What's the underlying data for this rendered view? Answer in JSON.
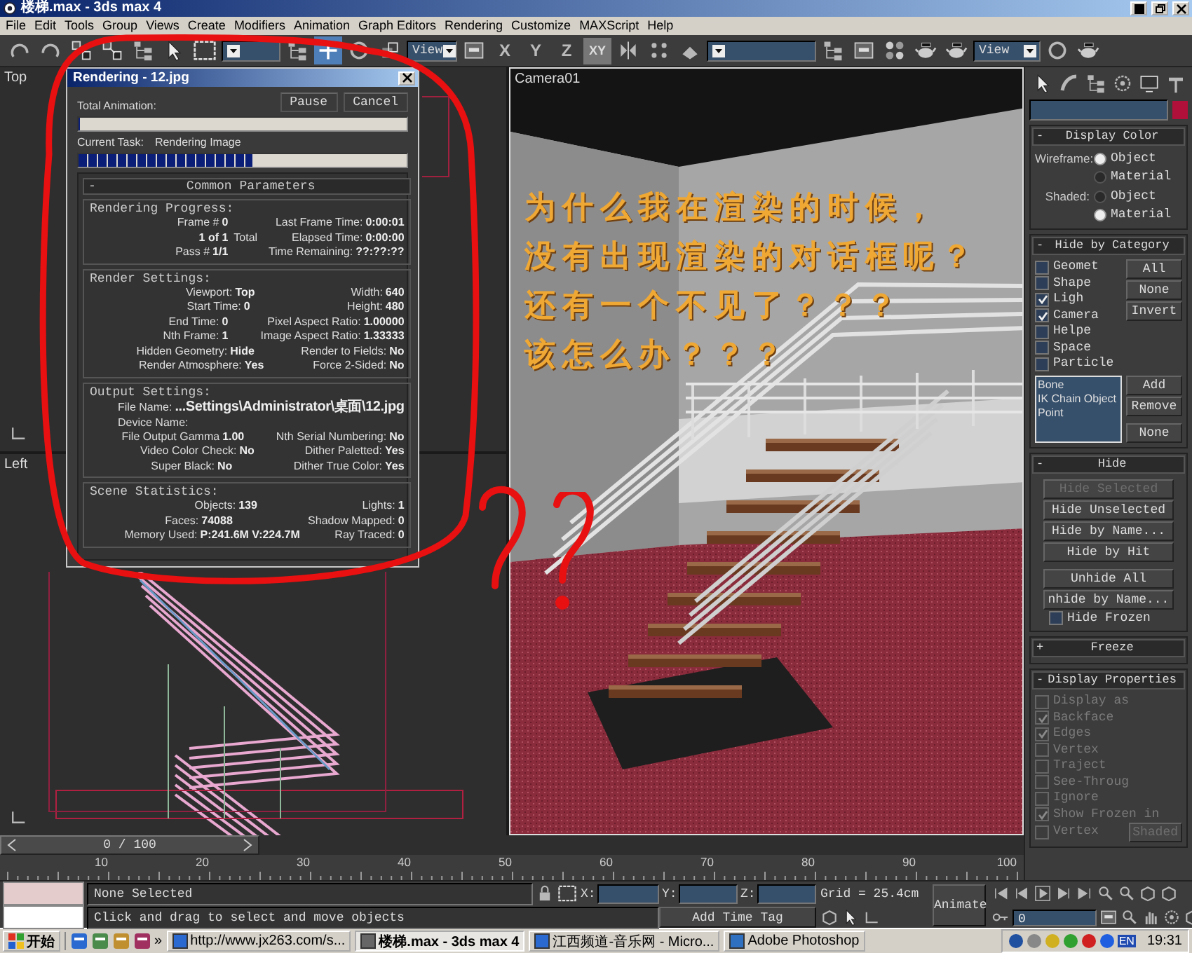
{
  "window": {
    "title": "楼梯.max - 3ds max 4"
  },
  "menu": [
    "File",
    "Edit",
    "Tools",
    "Group",
    "Views",
    "Create",
    "Modifiers",
    "Animation",
    "Graph Editors",
    "Rendering",
    "Customize",
    "MAXScript",
    "Help"
  ],
  "toolbar": {
    "view_dropdowns": [
      "View",
      "View"
    ],
    "axes": [
      {
        "label": "X",
        "selected": false
      },
      {
        "label": "Y",
        "selected": false
      },
      {
        "label": "Z",
        "selected": false
      },
      {
        "label": "XY",
        "selected": true
      }
    ]
  },
  "viewports": [
    {
      "label": "Top",
      "kind": "top"
    },
    {
      "label": "Left",
      "kind": "wireframe"
    },
    {
      "label": "Camera01",
      "kind": "render"
    }
  ],
  "annotation": [
    "为什么我在渲染的时候，",
    "没有出现渲染的对话框呢？",
    "还有一个不见了？？？",
    "该怎么办？？？"
  ],
  "render_dialog": {
    "title": "Rendering - 12.jpg",
    "buttons": [
      "Pause",
      "Cancel"
    ],
    "total": {
      "label": "Total Animation:",
      "level": 0
    },
    "task": {
      "label": "Current Task:",
      "value": "Rendering Image",
      "level": 0.53
    },
    "rollout": {
      "toggle": "-",
      "title": "Common Parameters"
    },
    "groups": [
      {
        "title": "Rendering Progress:",
        "rows": [
          {
            "left": {
              "label": "Frame #",
              "value": "0"
            },
            "right": {
              "label": "Last Frame Time:",
              "value": "0:00:01"
            }
          },
          {
            "left": {
              "value": "1 of 1"
            },
            "middle": "Total",
            "right": {
              "label": "Elapsed Time:",
              "value": "0:00:00"
            }
          },
          {
            "left": {
              "label": "Pass #",
              "value": "1/1"
            },
            "right": {
              "label": "Time Remaining:",
              "value": "??:??:??"
            }
          }
        ]
      },
      {
        "title": "Render Settings:",
        "rows": [
          {
            "left": {
              "label": "Viewport:",
              "value": "Top"
            },
            "right": {
              "label": "Width:",
              "value": "640"
            }
          },
          {
            "left": {
              "label": "Start Time:",
              "value": "0"
            },
            "right": {
              "label": "Height:",
              "value": "480"
            }
          },
          {
            "left": {
              "label": "End Time:",
              "value": "0"
            },
            "right": {
              "label": "Pixel Aspect Ratio:",
              "value": "1.00000"
            }
          },
          {
            "left": {
              "label": "Nth Frame:",
              "value": "1"
            },
            "right": {
              "label": "Image Aspect Ratio:",
              "value": "1.33333"
            }
          },
          {
            "left": {
              "label": "Hidden Geometry:",
              "value": "Hide"
            },
            "right": {
              "label": "Render to Fields:",
              "value": "No"
            }
          },
          {
            "left": {
              "label": "Render Atmosphere:",
              "value": "Yes"
            },
            "right": {
              "label": "Force 2-Sided:",
              "value": "No"
            }
          }
        ]
      },
      {
        "title": "Output Settings:",
        "rows": [
          {
            "full": {
              "label": "File Name:",
              "value": "...Settings\\Administrator\\桌面\\12.jpg"
            }
          },
          {
            "full": {
              "label": "Device Name:"
            }
          },
          {
            "left": {
              "label": "File Output Gamma",
              "value": "1.00"
            },
            "right": {
              "label": "Nth Serial Numbering:",
              "value": "No"
            }
          },
          {
            "left": {
              "label": "Video Color Check:",
              "value": "No"
            },
            "right": {
              "label": "Dither Paletted:",
              "value": "Yes"
            }
          },
          {
            "left": {
              "label": "Super Black:",
              "value": "No"
            },
            "right": {
              "label": "Dither True Color:",
              "value": "Yes"
            }
          }
        ]
      },
      {
        "title": "Scene Statistics:",
        "rows": [
          {
            "left": {
              "label": "Objects:",
              "value": "139"
            },
            "right": {
              "label": "Lights:",
              "value": "1"
            }
          },
          {
            "left": {
              "label": "Faces:",
              "value": "74088"
            },
            "right": {
              "label": "Shadow Mapped:",
              "value": "0"
            }
          },
          {
            "left": {
              "label": "Memory Used:",
              "value": "P:241.6M V:224.7M"
            },
            "right": {
              "label": "Ray Traced:",
              "value": "0"
            }
          }
        ]
      }
    ]
  },
  "command_panel": {
    "rollouts": [
      {
        "kind": "display_color",
        "toggle": "-",
        "title": "Display Color",
        "groups": [
          {
            "label": "Wireframe:",
            "options": [
              {
                "label": "Object",
                "selected": true
              },
              {
                "label": "Material",
                "selected": false
              }
            ]
          },
          {
            "label": "Shaded:",
            "options": [
              {
                "label": "Object",
                "selected": false
              },
              {
                "label": "Material",
                "selected": true
              }
            ]
          }
        ]
      },
      {
        "kind": "hide_by_category",
        "toggle": "-",
        "title": "Hide by Category",
        "checks": [
          {
            "label": "Geomet",
            "checked": false
          },
          {
            "label": "Shape",
            "checked": false
          },
          {
            "label": "Ligh",
            "checked": true
          },
          {
            "label": "Camera",
            "checked": true
          },
          {
            "label": "Helpe",
            "checked": false
          },
          {
            "label": "Space",
            "checked": false
          },
          {
            "label": "Particle",
            "checked": false
          }
        ],
        "buttons": [
          "All",
          "None",
          "Invert"
        ],
        "list": [
          "Bone",
          "IK Chain Object",
          "Point"
        ],
        "list_buttons": [
          "Add",
          "Remove",
          "None"
        ]
      },
      {
        "kind": "button_stack",
        "toggle": "-",
        "title": "Hide",
        "button_groups": [
          [
            {
              "label": "Hide Selected",
              "disabled": true
            },
            {
              "label": "Hide Unselected",
              "disabled": false
            },
            {
              "label": "Hide by Name...",
              "disabled": false
            },
            {
              "label": "Hide by Hit",
              "disabled": false
            }
          ],
          [
            {
              "label": "Unhide All",
              "disabled": false
            },
            {
              "label": "nhide by Name...",
              "disabled": false
            }
          ]
        ],
        "checks": [
          {
            "label": "Hide Frozen",
            "checked": false
          }
        ]
      },
      {
        "kind": "collapsed",
        "toggle": "+",
        "title": "Freeze"
      },
      {
        "kind": "display_properties",
        "toggle": "-",
        "title": "Display Properties",
        "checks": [
          {
            "label": "Display as",
            "checked": false,
            "disabled": true
          },
          {
            "label": "Backface",
            "checked": true,
            "disabled": true
          },
          {
            "label": "Edges",
            "checked": true,
            "disabled": true
          },
          {
            "label": "Vertex",
            "checked": false,
            "disabled": true
          },
          {
            "label": "Traject",
            "checked": false,
            "disabled": true
          },
          {
            "label": "See-Throug",
            "checked": false,
            "disabled": true
          },
          {
            "label": "Ignore",
            "checked": false,
            "disabled": true
          },
          {
            "label": "Show Frozen in",
            "checked": true,
            "disabled": true
          },
          {
            "label": "Vertex",
            "checked": false,
            "disabled": true
          }
        ],
        "button": {
          "label": "Shaded",
          "disabled": true
        }
      }
    ]
  },
  "timeline": {
    "position": "0 / 100",
    "level": 0,
    "ticks": [
      "10",
      "20",
      "30",
      "40",
      "50",
      "60",
      "70",
      "80",
      "90",
      "100"
    ]
  },
  "status": {
    "selection": "None Selected",
    "prompt": "Click and drag to select and move objects",
    "coords": [
      "X:",
      "Y:",
      "Z:"
    ],
    "grid": "Grid = 25.4cm",
    "time_tag": "Add Time Tag",
    "animate": "Animate",
    "frame": "0"
  },
  "taskbar": {
    "start": "开始",
    "chevron": "»",
    "tasks": [
      {
        "label": "http://www.jx263.com/s...",
        "selected": false
      },
      {
        "label": "楼梯.max - 3ds max 4",
        "selected": true
      },
      {
        "label": "江西频道-音乐网 - Micro...",
        "selected": false
      },
      {
        "label": "Adobe Photoshop",
        "selected": false
      }
    ],
    "language": "EN",
    "clock": "19:31"
  }
}
